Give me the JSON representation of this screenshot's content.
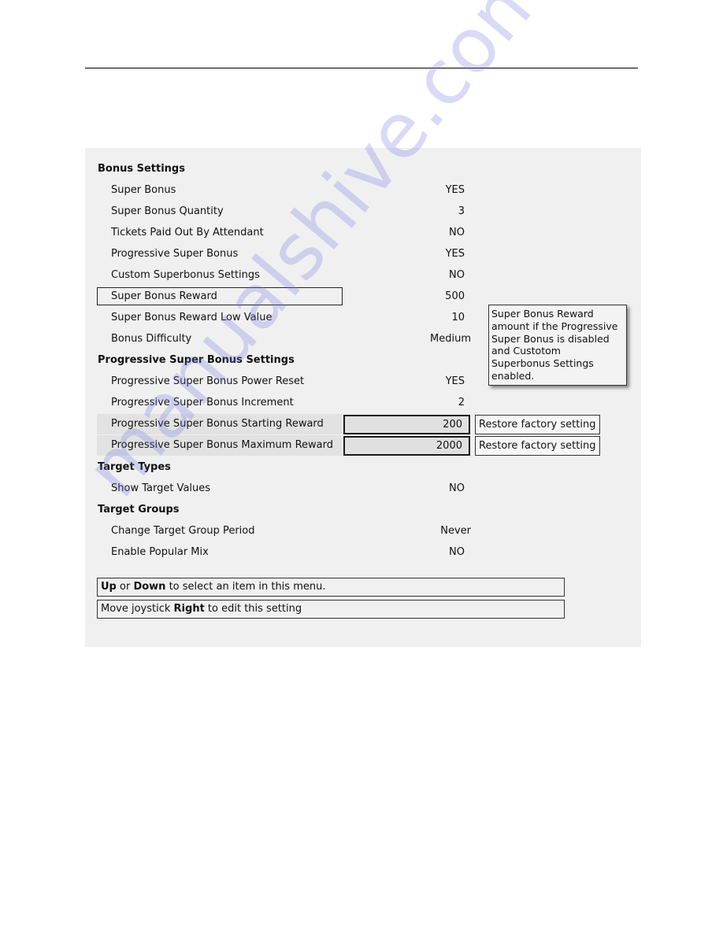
{
  "menu": {
    "sections": [
      {
        "title": "Bonus Settings",
        "items": [
          {
            "label": "Super Bonus",
            "value": "YES"
          },
          {
            "label": "Super Bonus Quantity",
            "value": "3"
          },
          {
            "label": "Tickets Paid Out By Attendant",
            "value": "NO"
          },
          {
            "label": "Progressive Super Bonus",
            "value": "YES"
          },
          {
            "label": "Custom Superbonus Settings",
            "value": "NO"
          },
          {
            "label": "Super Bonus Reward",
            "value": "500",
            "selected": true
          },
          {
            "label": "Super Bonus Reward Low Value",
            "value": "10"
          },
          {
            "label": "Bonus Difficulty",
            "value": "Medium"
          }
        ]
      },
      {
        "title": "Progressive Super Bonus Settings",
        "items": [
          {
            "label": "Progressive Super Bonus Power Reset",
            "value": "YES"
          },
          {
            "label": "Progressive Super Bonus Increment",
            "value": "2"
          },
          {
            "label": "Progressive Super Bonus Starting Reward",
            "value": "200",
            "restore_label": "Restore factory setting"
          },
          {
            "label": "Progressive Super Bonus Maximum Reward",
            "value": "2000",
            "restore_label": "Restore factory setting"
          }
        ]
      },
      {
        "title": "Target Types",
        "items": [
          {
            "label": "Show Target Values",
            "value": "NO"
          }
        ]
      },
      {
        "title": "Target Groups",
        "items": [
          {
            "label": "Change Target Group Period",
            "value": "Never"
          },
          {
            "label": "Enable Popular Mix",
            "value": "NO"
          }
        ]
      }
    ]
  },
  "tooltip": {
    "lines": [
      "Super Bonus Reward",
      "amount if the Progressive",
      "Super Bonus is disabled",
      "and Custotom",
      "Superbonus Settings",
      "enabled."
    ]
  },
  "hints": {
    "nav": {
      "b1": "Up",
      "t1": " or ",
      "b2": "Down",
      "t2": " to select an item in this menu."
    },
    "edit": {
      "t1": "Move joystick ",
      "b1": "Right",
      "t2": " to edit this setting"
    }
  },
  "watermark": "manualshive.com"
}
